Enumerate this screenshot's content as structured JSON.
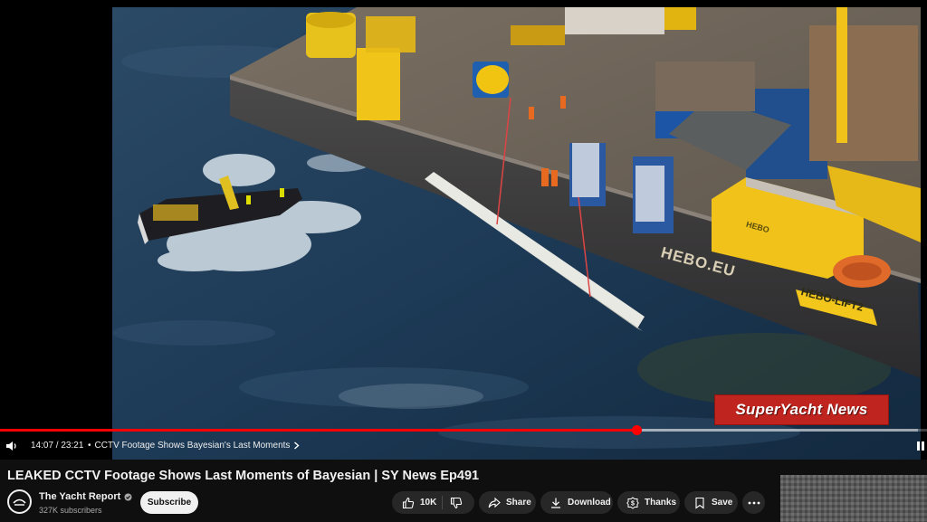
{
  "video": {
    "watermark": "SuperYacht News",
    "barge_hull_text": "HEBO.EU",
    "barge_lift_text": "HEBO-LIFT2",
    "cabin_text": "HEBO",
    "progress": {
      "played_fraction": 0.687,
      "loaded_fraction": 0.99
    }
  },
  "controls": {
    "current_time": "14:07",
    "separator": " / ",
    "duration": "23:21",
    "chapter_title": "CCTV Footage Shows Bayesian's Last Moments",
    "chapter_prefix": "•",
    "icons": [
      "volume-icon",
      "chevron-right-icon",
      "pause-icon"
    ]
  },
  "meta": {
    "title": "LEAKED CCTV Footage Shows Last Moments of Bayesian | SY News Ep491",
    "channel_name": "The Yacht Report",
    "subscribers": "327K subscribers",
    "subscribe_label": "Subscribe"
  },
  "actions": {
    "like_count": "10K",
    "share_label": "Share",
    "download_label": "Download",
    "thanks_label": "Thanks",
    "save_label": "Save"
  },
  "colors": {
    "background": "#0f0f0f",
    "progress": "#ff0000",
    "pill": "#272727",
    "subscribe_bg": "#f1f1f1",
    "watermark_bg": "#c0241e"
  }
}
